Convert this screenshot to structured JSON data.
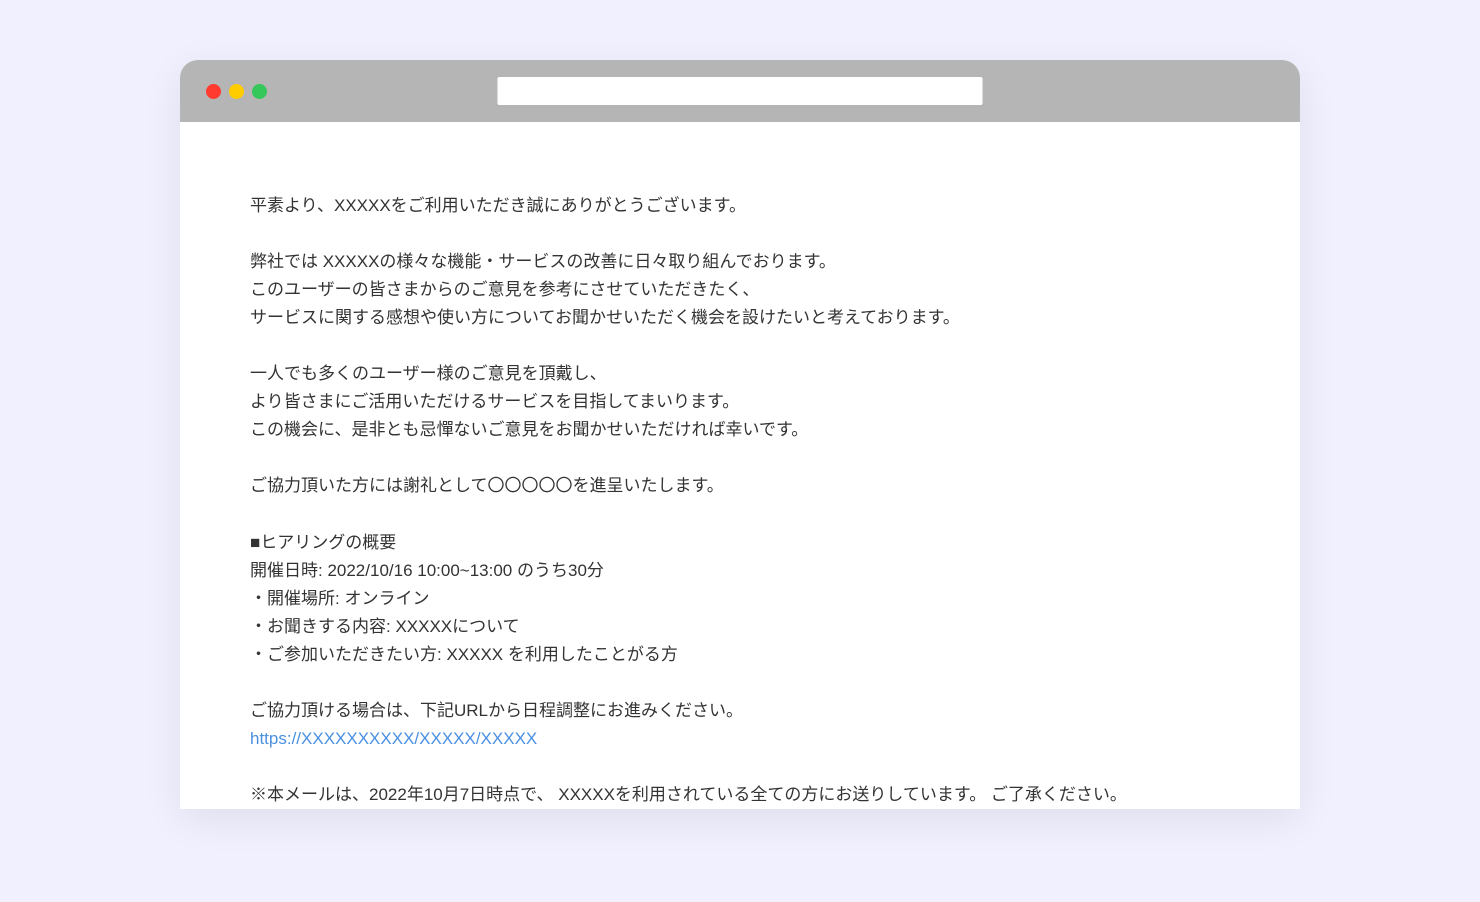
{
  "greeting": "平素より、XXXXXをご利用いただき誠にありがとうございます。",
  "intro": {
    "line1": "弊社では XXXXXの様々な機能・サービスの改善に日々取り組んでおります。",
    "line2": "このユーザーの皆さまからのご意見を参考にさせていただきたく、",
    "line3": "サービスに関する感想や使い方についてお聞かせいただく機会を設けたいと考えております。"
  },
  "purpose": {
    "line1": "一人でも多くのユーザー様のご意見を頂戴し、",
    "line2": "より皆さまにご活用いただけるサービスを目指してまいります。",
    "line3": "この機会に、是非とも忌憚ないご意見をお聞かせいただければ幸いです。"
  },
  "reward": "ご協力頂いた方には謝礼として〇〇〇〇〇を進呈いたします。",
  "overview": {
    "heading": "■ヒアリングの概要",
    "datetime": "開催日時: 2022/10/16 10:00~13:00 のうち30分",
    "location": "・開催場所: オンライン",
    "topic": "・お聞きする内容: XXXXXについて",
    "audience": "・ご参加いただきたい方: XXXXX を利用したことがる方"
  },
  "cta": "ご協力頂ける場合は、下記URLから日程調整にお進みください。",
  "url": "https://XXXXXXXXXX/XXXXX/XXXXX",
  "footnote": "※本メールは、2022年10月7日時点で、 XXXXXを利用されている全ての方にお送りしています。 ご了承ください。"
}
